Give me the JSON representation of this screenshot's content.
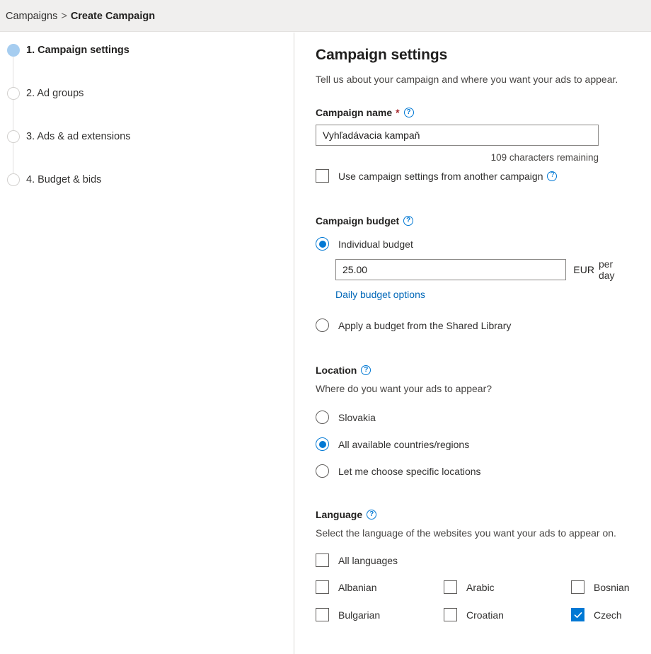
{
  "breadcrumb": {
    "root": "Campaigns",
    "separator": ">",
    "current": "Create Campaign"
  },
  "sidebar": {
    "steps": [
      {
        "label": "1. Campaign settings",
        "active": true
      },
      {
        "label": "2. Ad groups",
        "active": false
      },
      {
        "label": "3. Ads & ad extensions",
        "active": false
      },
      {
        "label": "4. Budget & bids",
        "active": false
      }
    ]
  },
  "main": {
    "title": "Campaign settings",
    "subtitle": "Tell us about your campaign and where you want your ads to appear.",
    "campaign_name": {
      "label": "Campaign name",
      "required_marker": "*",
      "help_icon": "help-circle-icon",
      "value": "Vyhľadávacia kampaň",
      "placeholder": "",
      "characters_remaining": "109 characters remaining"
    },
    "use_other_settings": {
      "label": "Use campaign settings from another campaign",
      "checked": false,
      "help_icon": "help-circle-icon"
    },
    "campaign_budget": {
      "heading": "Campaign budget",
      "help_icon": "help-circle-icon",
      "individual_option": "Individual budget",
      "individual_selected": true,
      "amount": "25.00",
      "currency": "EUR",
      "period": "per day",
      "daily_options_link": "Daily budget options",
      "shared_option": "Apply a budget from the Shared Library",
      "shared_selected": false
    },
    "location": {
      "heading": "Location",
      "help_icon": "help-circle-icon",
      "description": "Where do you want your ads to appear?",
      "options": [
        {
          "label": "Slovakia",
          "selected": false
        },
        {
          "label": "All available countries/regions",
          "selected": true
        },
        {
          "label": "Let me choose specific locations",
          "selected": false
        }
      ]
    },
    "language": {
      "heading": "Language",
      "help_icon": "help-circle-icon",
      "description": "Select the language of the websites you want your ads to appear on.",
      "all_languages": {
        "label": "All languages",
        "checked": false
      },
      "items": [
        {
          "label": "Albanian",
          "checked": false
        },
        {
          "label": "Arabic",
          "checked": false
        },
        {
          "label": "Bosnian",
          "checked": false
        },
        {
          "label": "Bulgarian",
          "checked": false
        },
        {
          "label": "Croatian",
          "checked": false
        },
        {
          "label": "Czech",
          "checked": true
        }
      ]
    }
  },
  "colors": {
    "accent": "#0078d4",
    "link": "#0067b8",
    "required": "#a4262c",
    "step_active": "#a6cdf0",
    "header_bg": "#f0efee"
  }
}
